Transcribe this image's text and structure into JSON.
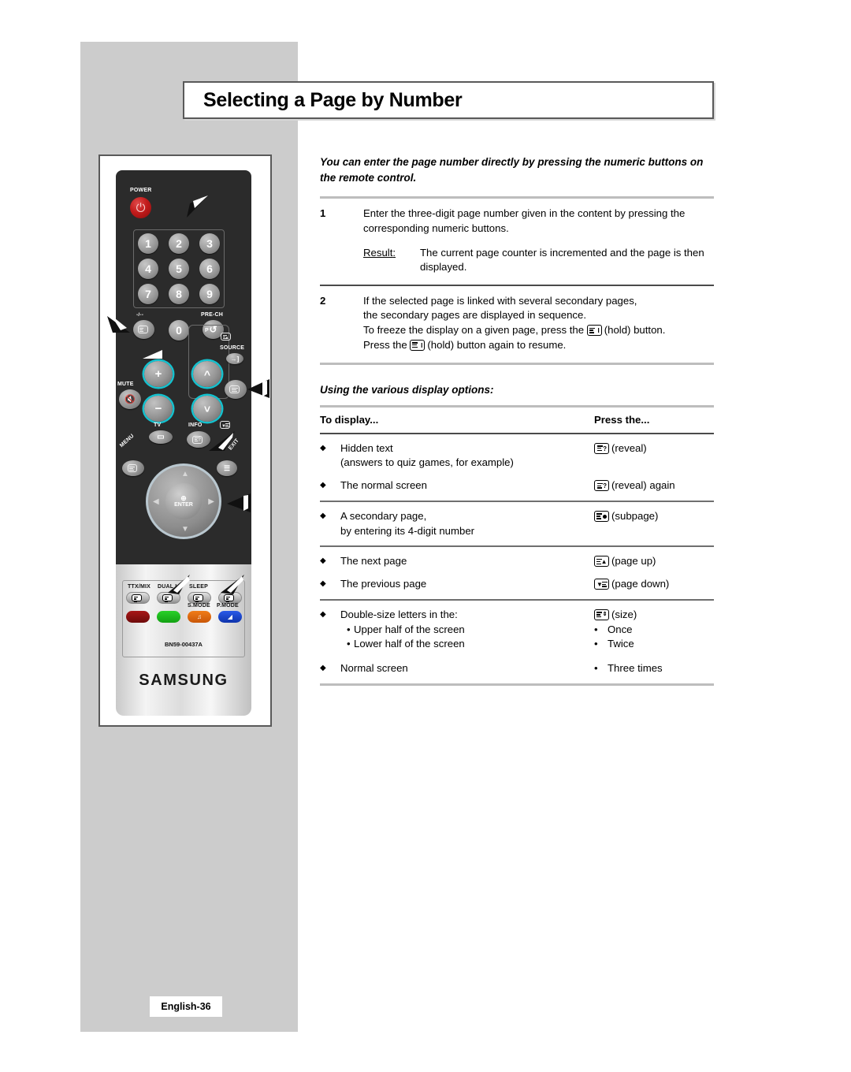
{
  "page": {
    "title": "Selecting a Page by Number",
    "footer_label": "English-36",
    "intro": "You can enter the page number directly by pressing the numeric buttons on the remote control."
  },
  "steps": [
    {
      "num": "1",
      "text": "Enter the three-digit page number given in the content by pressing the corresponding numeric buttons.",
      "result_label": "Result",
      "result_colon": ":",
      "result_text": "The current page counter is incremented and the page is then displayed."
    },
    {
      "num": "2",
      "line1": "If the selected page is linked with several secondary pages,",
      "line2": "the secondary pages are displayed in sequence.",
      "line3_a": "To freeze the display on a given page, press the",
      "line3_b": "(hold) button.",
      "line4_a": "Press the",
      "line4_b": "(hold) button again to resume."
    }
  ],
  "table": {
    "heading": "Using the various display options:",
    "col_a_header": "To display...",
    "col_b_header": "Press the...",
    "groups": [
      {
        "rows": [
          {
            "display": "Hidden text",
            "display_sub": "(answers to quiz games, for example)",
            "press_icon": "teletext-reveal-icon",
            "press": "(reveal)"
          },
          {
            "display": "The normal screen",
            "press_icon": "teletext-reveal-icon",
            "press": "(reveal) again"
          }
        ]
      },
      {
        "rows": [
          {
            "display": "A secondary page,",
            "display_sub": "by entering its 4-digit number",
            "press_icon": "teletext-subpage-icon",
            "press": "(subpage)"
          }
        ]
      },
      {
        "rows": [
          {
            "display": "The next page",
            "press_icon": "teletext-page-up-icon",
            "press": "(page up)"
          },
          {
            "display": "The previous page",
            "press_icon": "teletext-page-down-icon",
            "press": "(page down)"
          }
        ]
      },
      {
        "rows": [
          {
            "display": "Double-size letters in the:",
            "press_icon": "teletext-size-icon",
            "press": "(size)",
            "sub_items": [
              {
                "display": "Upper half of the screen",
                "press": "Once"
              },
              {
                "display": "Lower half of the screen",
                "press": "Twice"
              }
            ]
          },
          {
            "display": "Normal screen",
            "press": "Three times"
          }
        ]
      }
    ]
  },
  "remote": {
    "labels": {
      "power": "POWER",
      "minus_slash": "-/--",
      "pre_ch": "PRE-CH",
      "mute": "MUTE",
      "p": "P",
      "source": "SOURCE",
      "tv": "TV",
      "info": "INFO",
      "menu": "MENU",
      "exit": "EXIT",
      "enter": "ENTER",
      "ttx_mix": "TTX/MIX",
      "dual": "DUAL I-II",
      "sleep": "SLEEP",
      "s_mode": "S.MODE",
      "p_mode": "P.MODE",
      "model": "BN59-00437A",
      "brand": "SAMSUNG"
    },
    "keypad": [
      "1",
      "2",
      "3",
      "4",
      "5",
      "6",
      "7",
      "8",
      "9",
      "0"
    ],
    "volume_plus": "+",
    "volume_minus": "−",
    "colors": {
      "highlight_ring": "#14c2cf",
      "power_red": "#c21c1c",
      "key_red": "#8e1111",
      "key_green": "#1eb91e",
      "key_orange": "#e06a10",
      "key_blue": "#1446d0",
      "shell_dark": "#2b2b2b",
      "panel_gray": "#cccccc"
    }
  }
}
